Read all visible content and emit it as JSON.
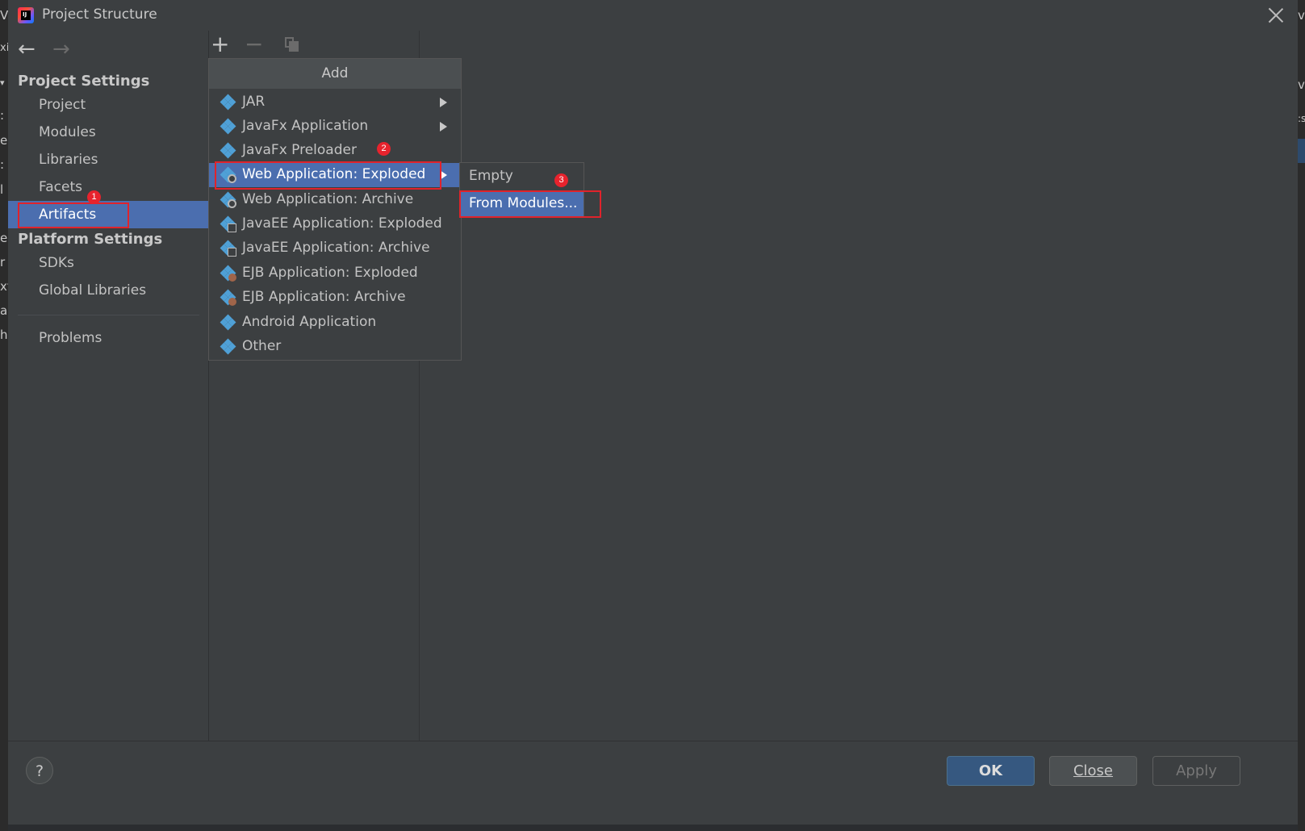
{
  "window": {
    "title": "Project Structure"
  },
  "edges": {
    "left": [
      "V",
      "xi",
      "▾",
      ":",
      "e",
      ":",
      "l",
      "el",
      "r",
      "xt",
      "a",
      "h"
    ],
    "right": [
      "v",
      "v",
      ":s"
    ]
  },
  "sidebar": {
    "project_settings_header": "Project Settings",
    "project_settings_items": [
      "Project",
      "Modules",
      "Libraries",
      "Facets",
      "Artifacts"
    ],
    "platform_settings_header": "Platform Settings",
    "platform_settings_items": [
      "SDKs",
      "Global Libraries"
    ],
    "problems": "Problems",
    "selected": "Artifacts"
  },
  "toolbar": {
    "add": "+",
    "remove": "−"
  },
  "add_menu": {
    "title": "Add",
    "items": [
      {
        "label": "JAR",
        "icon": "artifact-icon",
        "has_submenu": true
      },
      {
        "label": "JavaFx Application",
        "icon": "artifact-icon",
        "has_submenu": true
      },
      {
        "label": "JavaFx Preloader",
        "icon": "artifact-icon",
        "has_submenu": false
      },
      {
        "label": "Web Application: Exploded",
        "icon": "web-artifact-icon",
        "has_submenu": true,
        "selected": true
      },
      {
        "label": "Web Application: Archive",
        "icon": "web-artifact-icon",
        "has_submenu": false
      },
      {
        "label": "JavaEE Application: Exploded",
        "icon": "javaee-artifact-icon",
        "has_submenu": false
      },
      {
        "label": "JavaEE Application: Archive",
        "icon": "javaee-artifact-icon",
        "has_submenu": false
      },
      {
        "label": "EJB Application: Exploded",
        "icon": "ejb-artifact-icon",
        "has_submenu": false
      },
      {
        "label": "EJB Application: Archive",
        "icon": "ejb-artifact-icon",
        "has_submenu": false
      },
      {
        "label": "Android Application",
        "icon": "artifact-icon",
        "has_submenu": false
      },
      {
        "label": "Other",
        "icon": "artifact-icon",
        "has_submenu": false
      }
    ]
  },
  "submenu": {
    "items": [
      {
        "label": "Empty",
        "selected": false
      },
      {
        "label": "From Modules...",
        "selected": true
      }
    ]
  },
  "annotations": {
    "badge1": "1",
    "badge2": "2",
    "badge3": "3",
    "color": "#e0232b"
  },
  "footer": {
    "help": "?",
    "ok": "OK",
    "close": "Close",
    "apply": "Apply"
  },
  "colors": {
    "selection": "#4b6eaf",
    "background": "#3c3f41",
    "ok_button": "#365880"
  }
}
